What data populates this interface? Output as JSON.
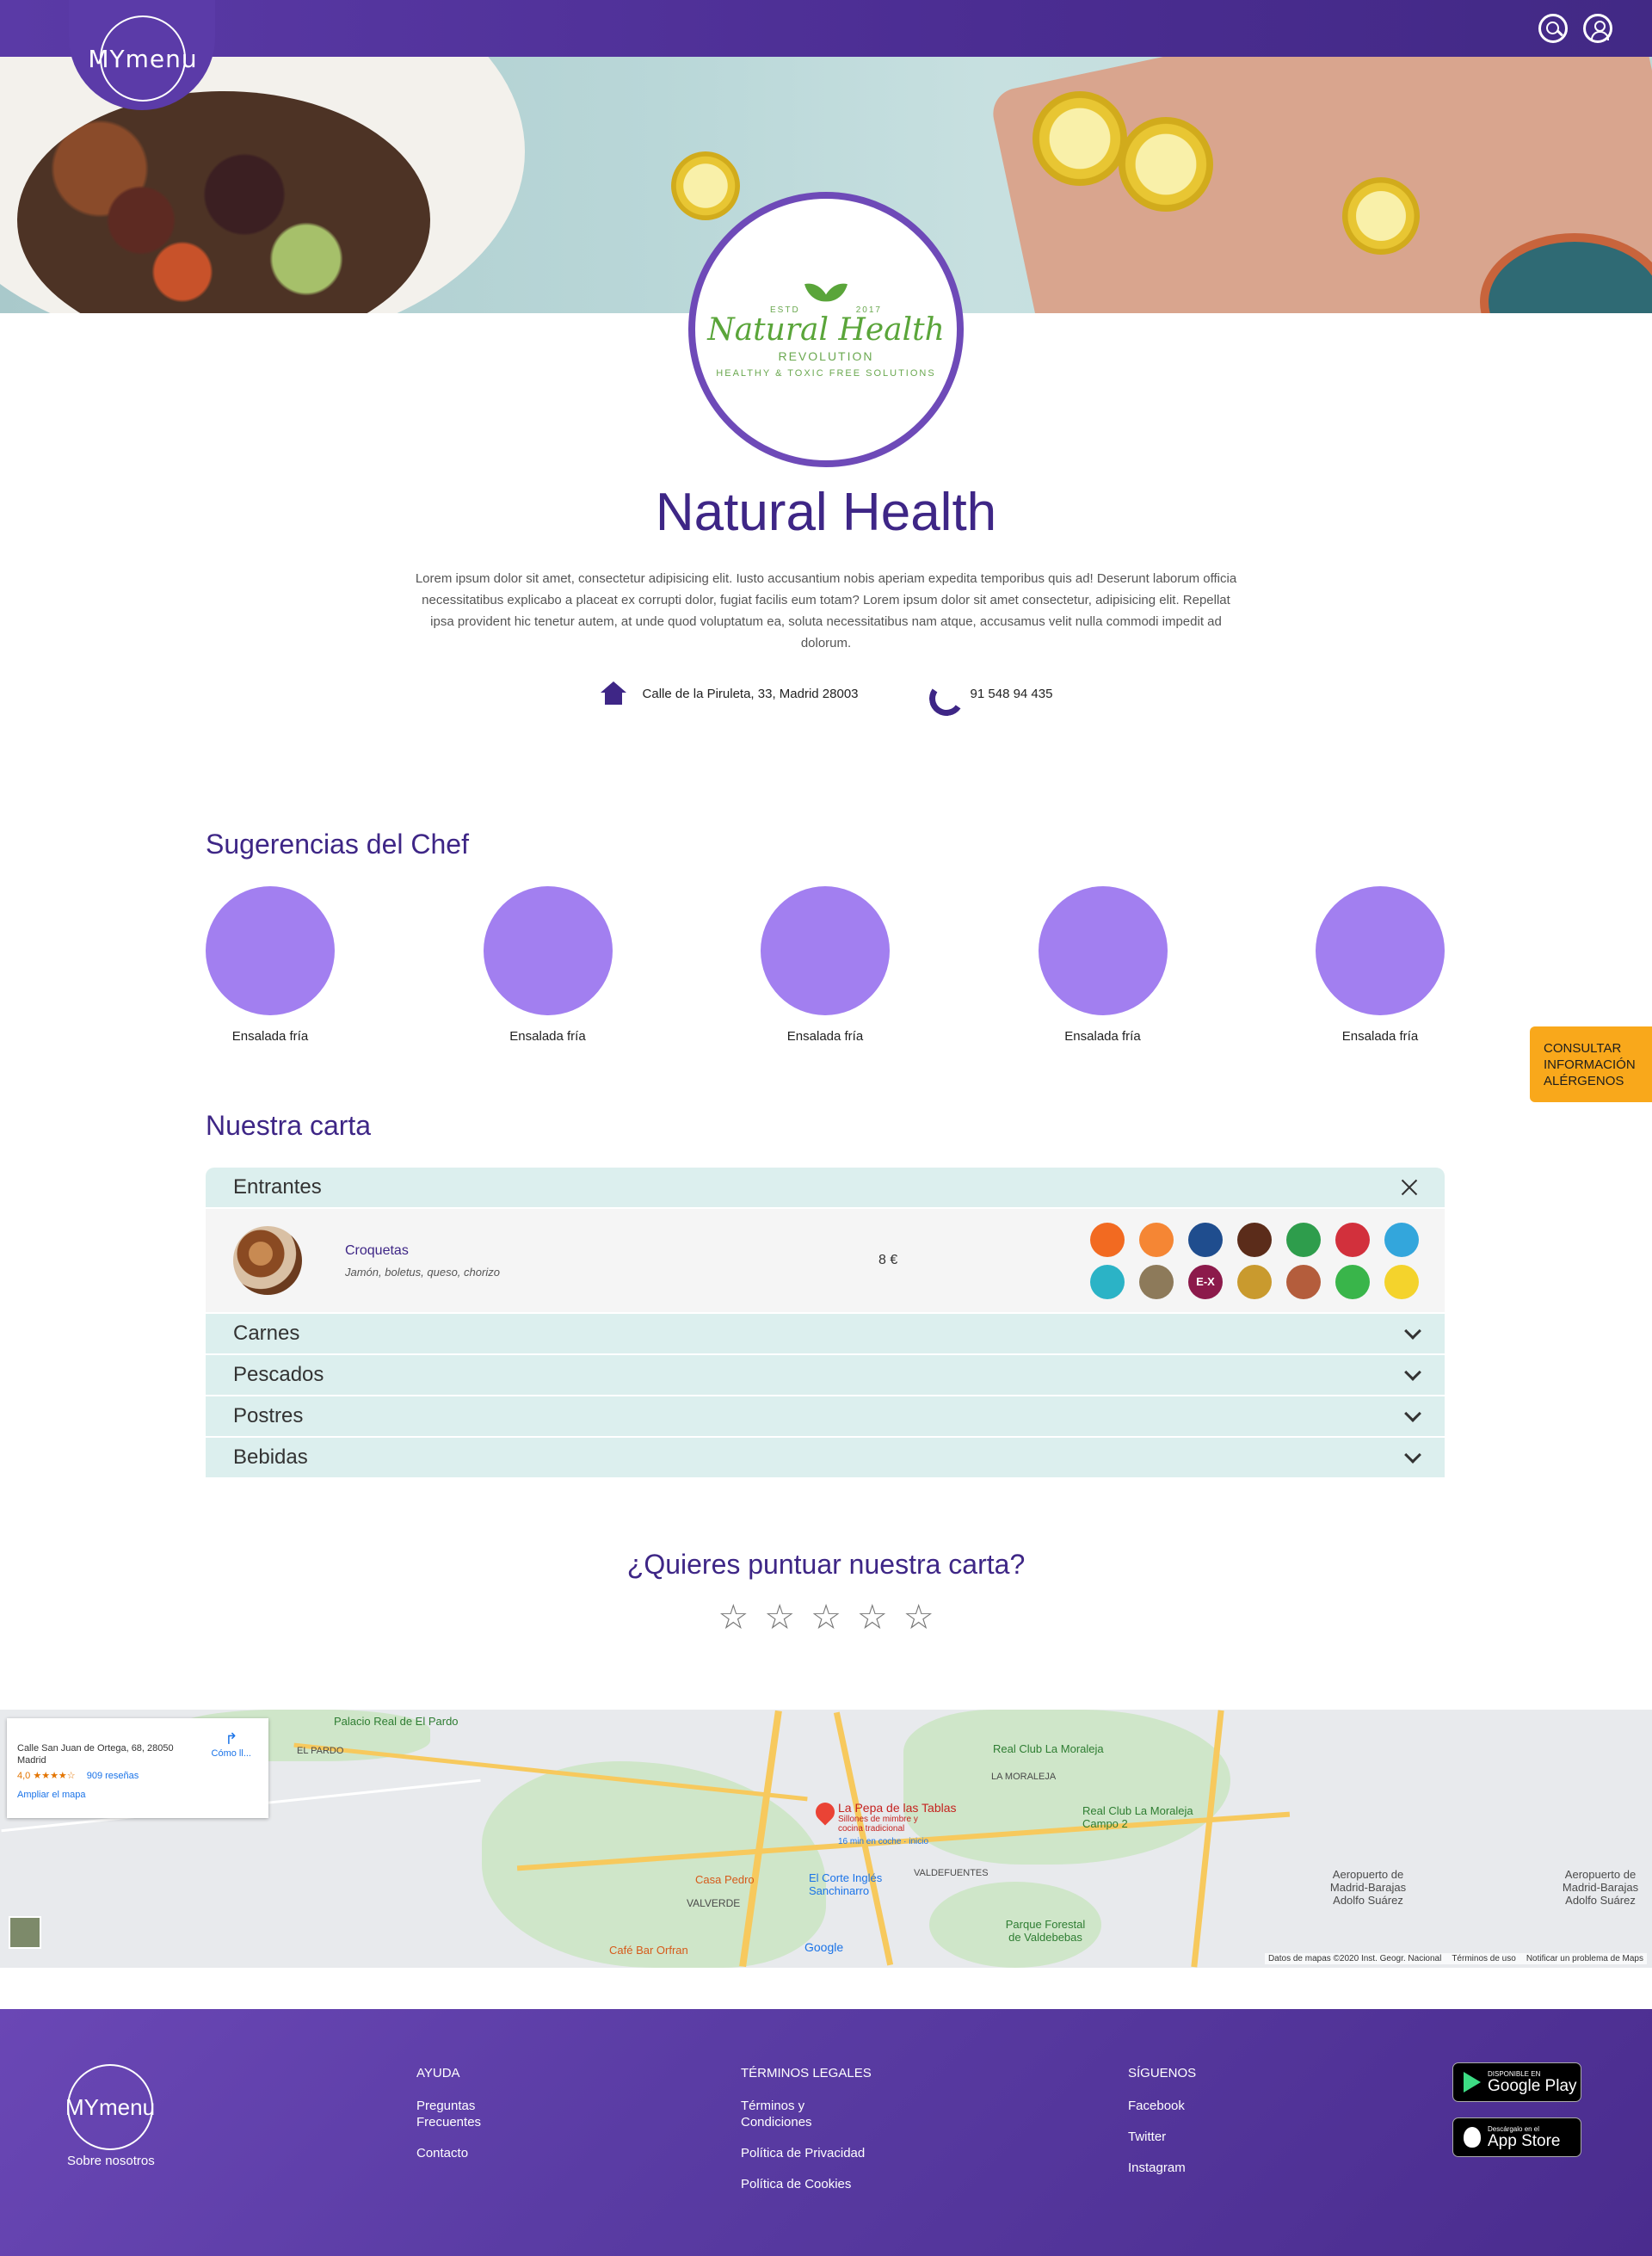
{
  "header": {
    "logo_text": "MYmenu",
    "icons": [
      "search-icon",
      "user-icon"
    ]
  },
  "restaurant": {
    "logo": {
      "estd_left": "ESTD",
      "estd_right": "2017",
      "brand": "Natural Health",
      "sub": "REVOLUTION",
      "tagline": "HEALTHY & TOXIC FREE SOLUTIONS"
    },
    "name": "Natural Health",
    "description": "Lorem ipsum dolor sit amet, consectetur adipisicing elit. Iusto accusantium nobis aperiam expedita temporibus quis ad! Deserunt laborum officia necessitatibus explicabo a placeat ex corrupti dolor, fugiat facilis eum totam? Lorem ipsum dolor sit amet consectetur, adipisicing elit. Repellat ipsa provident hic tenetur autem, at unde quod voluptatum ea, soluta necessitatibus nam atque, accusamus velit nulla commodi impedit ad dolorum.",
    "address": "Calle de la Piruleta, 33, Madrid 28003",
    "phone": "91 548 94 435"
  },
  "chef": {
    "title": "Sugerencias del Chef",
    "items": [
      {
        "label": "Ensalada fría"
      },
      {
        "label": "Ensalada fría"
      },
      {
        "label": "Ensalada fría"
      },
      {
        "label": "Ensalada fría"
      },
      {
        "label": "Ensalada fría"
      }
    ]
  },
  "allergen_tab": {
    "line1": "CONSULTAR",
    "line2": "INFORMACIÓN",
    "line3": "ALÉRGENOS"
  },
  "menu": {
    "title": "Nuestra carta",
    "open_section": "Entrantes",
    "dish": {
      "name": "Croquetas",
      "description": "Jamón, boletus, queso, chorizo",
      "price": "8 €",
      "allergen_colors": [
        "#f26a21",
        "#f58634",
        "#1f4d8e",
        "#5b2c1a",
        "#2e9d4c",
        "#d2303c",
        "#33a6dc",
        "#2bb3c6",
        "#8d7a5a",
        "#8c1a4b",
        "#c99a2e",
        "#b45d3c",
        "#39b54a",
        "#f4d32c"
      ],
      "allergen_symbols": [
        "",
        "",
        "",
        "",
        "",
        "",
        "",
        "",
        "",
        "E-X",
        "",
        "",
        "",
        ""
      ]
    },
    "sections": [
      "Carnes",
      "Pescados",
      "Postres",
      "Bebidas"
    ]
  },
  "rating": {
    "title": "¿Quieres puntuar nuestra carta?",
    "stars": [
      "☆",
      "☆",
      "☆",
      "☆",
      "☆"
    ]
  },
  "map": {
    "card": {
      "address": "Calle San Juan de Ortega, 68, 28050 Madrid",
      "score": "4,0 ★★★★☆",
      "reviews": "909 reseñas",
      "expand": "Ampliar el mapa",
      "directions": "Cómo ll..."
    },
    "labels": {
      "palacio": "Palacio Real de El Pardo",
      "el_pardo": "EL PARDO",
      "club_moraleja": "Real Club La Moraleja",
      "la_moraleja": "LA MORALEJA",
      "pepa": "La Pepa de las Tablas",
      "pepa_sub": "Sillones de mimbre y cocina tradicional",
      "pepa_time": "16 min en coche · inicio",
      "club_moraleja2": "Real Club La Moraleja Campo 2",
      "casa_pedro": "Casa Pedro",
      "corte_ingles": "El Corte Inglés Sanchinarro",
      "valdefuentes": "VALDEFUENTES",
      "valverde": "VALVERDE",
      "parque": "Parque Forestal de Valdebebas",
      "aeropuerto": "Aeropuerto de Madrid-Barajas Adolfo Suárez",
      "cafe_orfran": "Café Bar Orfran",
      "google": "Google"
    },
    "footer": [
      "Datos de mapas ©2020 Inst. Geogr. Nacional",
      "Términos de uso",
      "Notificar un problema de Maps"
    ]
  },
  "footer": {
    "logo_text": "MYmenu",
    "about": "Sobre nosotros",
    "ayuda": {
      "title": "AYUDA",
      "links": [
        "Preguntas Frecuentes",
        "Contacto"
      ]
    },
    "legal": {
      "title": "TÉRMINOS LEGALES",
      "links": [
        "Términos y Condiciones",
        "Política de Privacidad",
        "Política de Cookies"
      ]
    },
    "social": {
      "title": "SÍGUENOS",
      "links": [
        "Facebook",
        "Twitter",
        "Instagram"
      ]
    },
    "google_play": {
      "small": "DISPONIBLE EN",
      "big": "Google Play"
    },
    "app_store": {
      "small": "Descárgalo en el",
      "big": "App Store"
    }
  }
}
